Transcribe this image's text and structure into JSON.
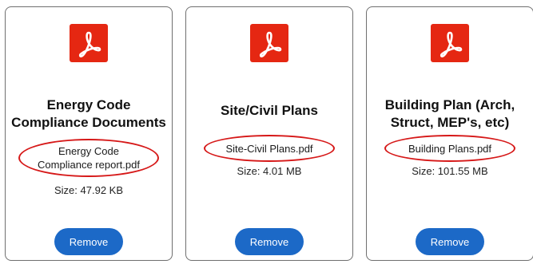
{
  "documents": [
    {
      "title": "Energy Code Compliance Documents",
      "filename": "Energy Code Compliance report.pdf",
      "size": "Size: 47.92 KB",
      "remove_label": "Remove",
      "icon": "pdf-icon"
    },
    {
      "title": "Site/Civil Plans",
      "filename": "Site-Civil Plans.pdf",
      "size": "Size: 4.01 MB",
      "remove_label": "Remove",
      "icon": "pdf-icon"
    },
    {
      "title": "Building Plan (Arch, Struct, MEP's, etc)",
      "filename": "Building Plans.pdf",
      "size": "Size: 101.55 MB",
      "remove_label": "Remove",
      "icon": "pdf-icon"
    }
  ],
  "colors": {
    "pdf_icon_bg": "#e52712",
    "highlight_ring": "#d61818",
    "button_bg": "#1c69c7",
    "card_border": "#6f6f6f"
  }
}
